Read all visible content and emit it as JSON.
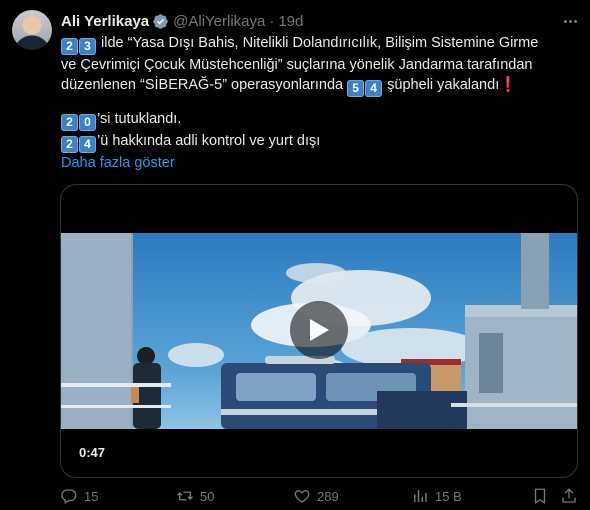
{
  "author": {
    "name": "Ali Yerlikaya",
    "handle": "@AliYerlikaya",
    "separator": "·",
    "time": "19d"
  },
  "tweet": {
    "line1_badge": "2 3",
    "line1_text": " ilde “Yasa Dışı Bahis, Nitelikli Dolandırıcılık, Bilişim Sistemine Girme",
    "line2_text": "ve Çevrimiçi Çocuk Müstehcenliği” suçlarına yönelik Jandarma tarafından",
    "line3_text_a": "düzenlenen “SİBERAĞ-5” operasyonlarında ",
    "line3_badge": "5 4",
    "line3_text_b": " şüpheli yakalandı",
    "line3_excl": "❗",
    "line4_badge": "2 0",
    "line4_text": "’si tutuklandı.",
    "line5_badge": "2 4",
    "line5_text": "’ü hakkında adli kontrol ve yurt dışı",
    "show_more": "Daha fazla göster"
  },
  "media": {
    "duration": "0:47"
  },
  "actions": {
    "replies": "15",
    "reposts": "50",
    "likes": "289",
    "views": "15 B"
  },
  "colors": {
    "accent": "#1d9bf0",
    "muted": "#71767b",
    "text": "#e7e9ea",
    "background": "#000000",
    "keycap": "#3b82c4"
  },
  "icons": [
    "verified-badge-icon",
    "more-options-icon",
    "play-icon",
    "reply-icon",
    "repost-icon",
    "like-icon",
    "views-icon",
    "bookmark-icon",
    "share-icon"
  ]
}
